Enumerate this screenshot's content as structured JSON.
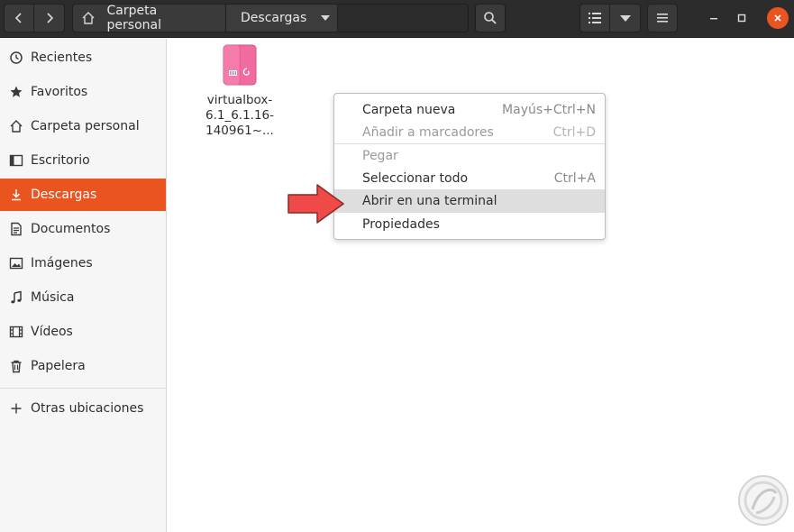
{
  "header": {
    "breadcrumb_home": "Carpeta personal",
    "breadcrumb_current": "Descargas",
    "icons": {
      "back": "chevron-left-icon",
      "forward": "chevron-right-icon",
      "home": "home-icon",
      "search": "search-icon",
      "list_view": "list-view-icon",
      "view_options": "chevron-down-icon",
      "menu": "hamburger-menu-icon",
      "minimize": "minimize-icon",
      "maximize": "maximize-icon",
      "close": "close-icon"
    }
  },
  "sidebar": {
    "items": [
      {
        "label": "Recientes",
        "icon": "clock-icon"
      },
      {
        "label": "Favoritos",
        "icon": "star-icon"
      },
      {
        "label": "Carpeta personal",
        "icon": "home-icon"
      },
      {
        "label": "Escritorio",
        "icon": "desktop-icon"
      },
      {
        "label": "Descargas",
        "icon": "download-icon",
        "active": true
      },
      {
        "label": "Documentos",
        "icon": "document-icon"
      },
      {
        "label": "Imágenes",
        "icon": "image-icon"
      },
      {
        "label": "Música",
        "icon": "music-icon"
      },
      {
        "label": "Vídeos",
        "icon": "video-icon"
      },
      {
        "label": "Papelera",
        "icon": "trash-icon"
      }
    ],
    "other_locations": {
      "label": "Otras ubicaciones",
      "icon": "plus-icon"
    }
  },
  "files": [
    {
      "name_lines": [
        "virtualbox-",
        "6.1_6.1.16-",
        "140961~..."
      ],
      "icon": "debian-package-icon"
    }
  ],
  "context_menu": {
    "items": [
      {
        "label": "Carpeta nueva",
        "accel": "Mayús+Ctrl+N",
        "disabled": false
      },
      {
        "label": "Añadir a marcadores",
        "accel": "Ctrl+D",
        "disabled": true
      },
      {
        "label": "Pegar",
        "accel": "",
        "disabled": true
      },
      {
        "label": "Seleccionar todo",
        "accel": "Ctrl+A",
        "disabled": false
      },
      {
        "label": "Abrir en una terminal",
        "accel": "",
        "disabled": false,
        "highlighted": true
      },
      {
        "label": "Propiedades",
        "accel": "",
        "disabled": false
      }
    ]
  },
  "colors": {
    "accent": "#e95420",
    "headerbar": "#2c2c2c",
    "sidebar_bg": "#f6f6f6",
    "annotation_arrow": "#f04a48",
    "package_icon": "#f06ca0"
  }
}
